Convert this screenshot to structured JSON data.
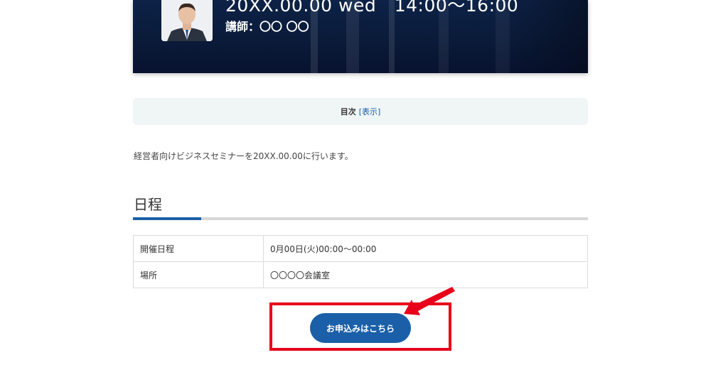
{
  "hero": {
    "date_line": "20XX.00.00 wed　14:00〜16:00",
    "lecturer": "講師：〇〇 〇〇"
  },
  "toc": {
    "title": "目次",
    "toggle": "[表示]"
  },
  "intro": "経営者向けビジネスセミナーを20XX.00.00に行います。",
  "schedule": {
    "title": "日程",
    "rows": [
      {
        "label": "開催日程",
        "value": "0月00日(火)00:00〜00:00"
      },
      {
        "label": "場所",
        "value": "〇〇〇〇会議室"
      }
    ]
  },
  "cta": {
    "label": "お申込みはこちら"
  },
  "colors": {
    "accent": "#1a5fa8",
    "highlight": "#e8001a",
    "toc_bg": "#f0f5f6"
  }
}
